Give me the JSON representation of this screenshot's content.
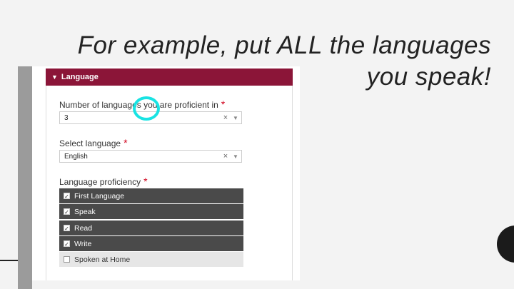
{
  "slide": {
    "title_line1": "For example, put ALL the languages",
    "title_line2": "you speak!"
  },
  "panel": {
    "caret": "▼",
    "title": "Language"
  },
  "fields": {
    "num_languages": {
      "label": "Number of languages you are proficient in",
      "required_mark": "*",
      "value": "3",
      "clear_icon": "×",
      "arrow_icon": "▼"
    },
    "select_language": {
      "label": "Select language",
      "required_mark": "*",
      "value": "English",
      "clear_icon": "×",
      "arrow_icon": "▼"
    },
    "proficiency": {
      "label": "Language proficiency",
      "required_mark": "*",
      "options": [
        {
          "label": "First Language",
          "checked": true,
          "mark": "✓"
        },
        {
          "label": "Speak",
          "checked": true,
          "mark": "✓"
        },
        {
          "label": "Read",
          "checked": true,
          "mark": "✓"
        },
        {
          "label": "Write",
          "checked": true,
          "mark": "✓"
        },
        {
          "label": "Spoken at Home",
          "checked": false,
          "mark": ""
        }
      ]
    }
  },
  "colors": {
    "header_bg": "#8b1538",
    "checked_row_bg": "#4a4a4a",
    "highlight": "#19e3e3"
  }
}
